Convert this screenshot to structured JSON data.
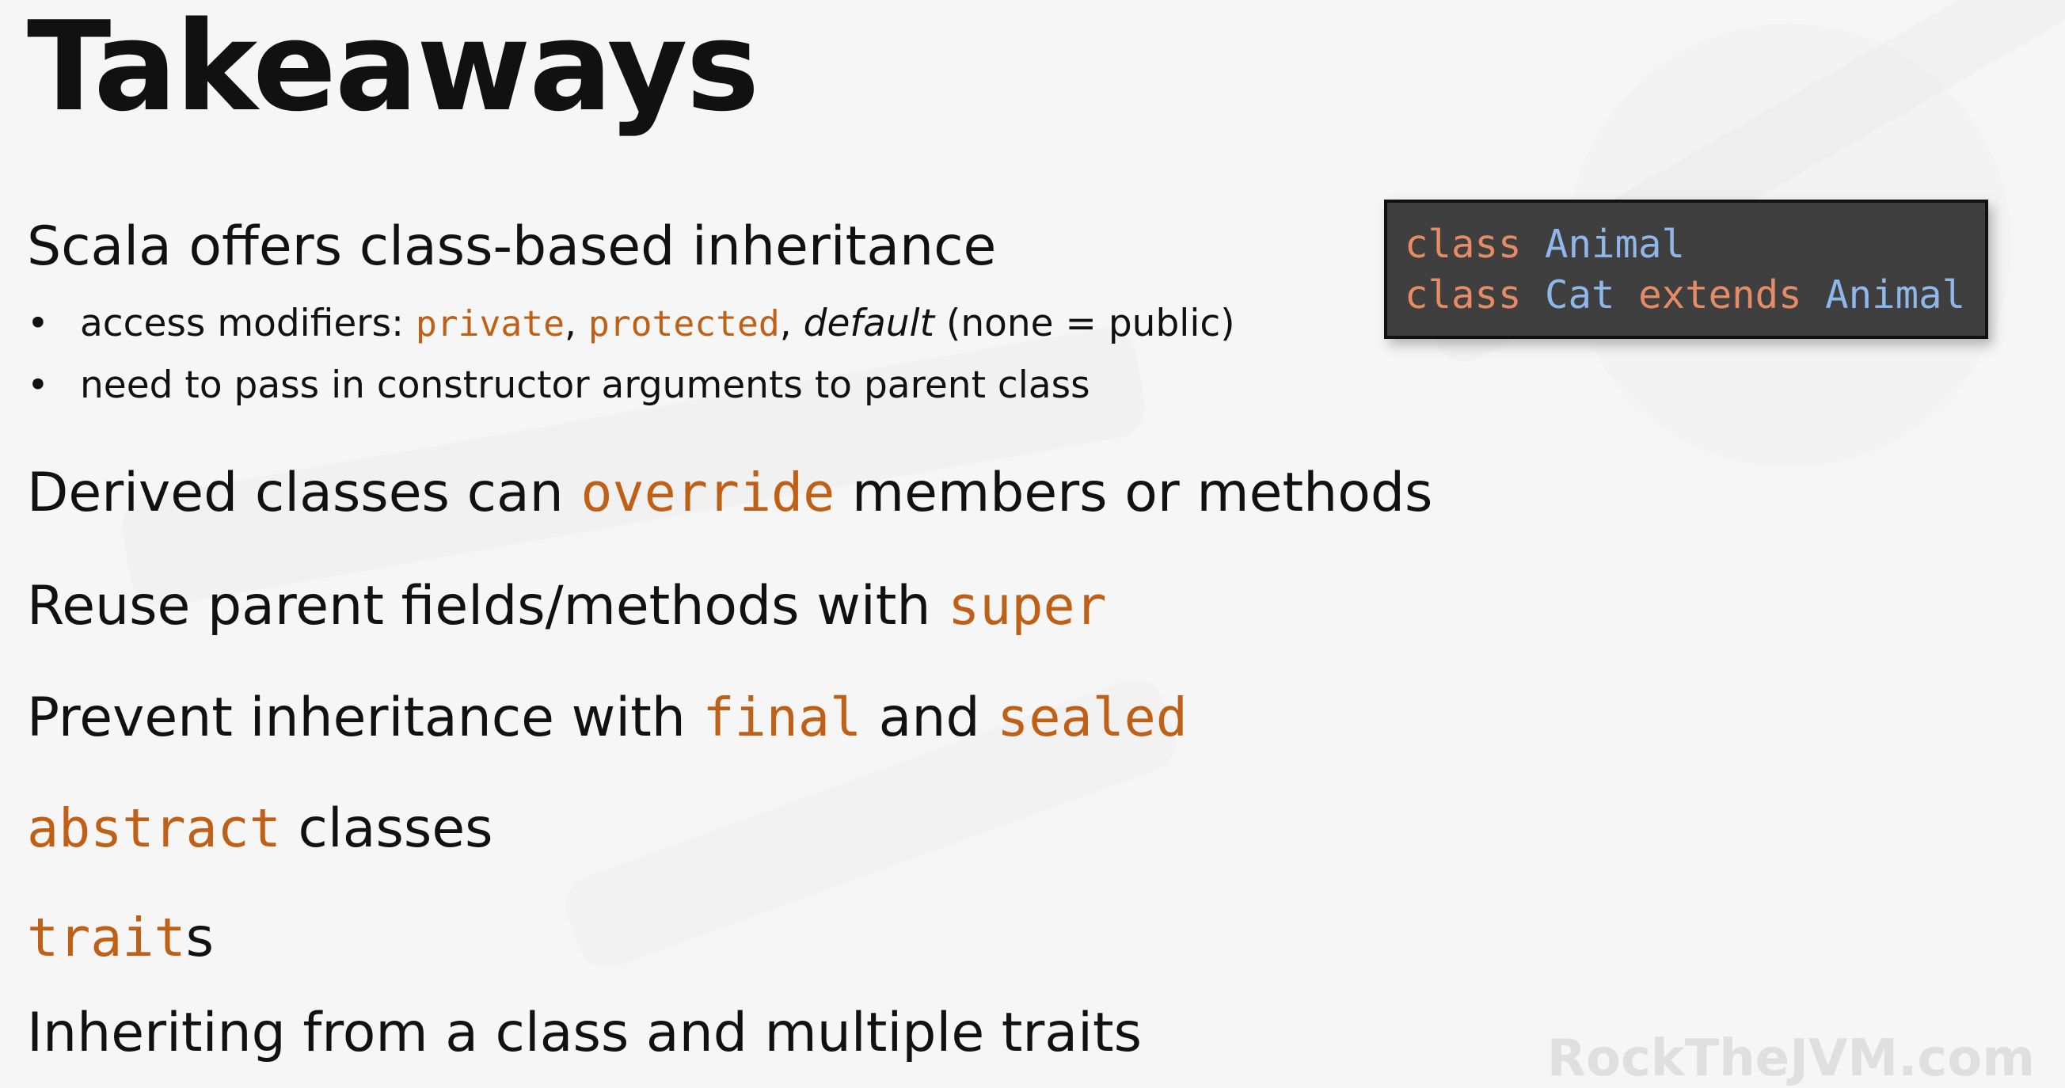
{
  "slide": {
    "title": "Takeaways",
    "item1": {
      "text": "Scala offers class-based inheritance",
      "bullets": [
        {
          "marker": "•",
          "prefix": "access modifiers: ",
          "private": "private",
          "comma1": ", ",
          "protected": "protected",
          "comma2": ", ",
          "default": "default",
          "suffix": " (none = public)"
        },
        {
          "marker": "•",
          "text": "need to pass in constructor arguments to parent class"
        }
      ]
    },
    "item2": {
      "before": "Derived classes can ",
      "code": "override",
      "after": " members or methods"
    },
    "item3": {
      "before": "Reuse parent fields/methods with ",
      "code": "super"
    },
    "item4": {
      "before": "Prevent inheritance with ",
      "code1": "final",
      "middle": " and ",
      "code2": "sealed"
    },
    "item5": {
      "code": "abstract",
      "after": " classes"
    },
    "item6": {
      "code": "trait",
      "after": "s"
    },
    "item7": {
      "text": "Inheriting from a class and multiple traits"
    }
  },
  "code_snippet": {
    "line1": {
      "keyword": "class",
      "space": " ",
      "name": "Animal"
    },
    "line2": {
      "keyword1": "class",
      "space1": " ",
      "name": "Cat",
      "space2": " ",
      "keyword2": "extends",
      "space3": " ",
      "parent": "Animal"
    }
  },
  "watermark": "RockTheJVM.com",
  "colors": {
    "background": "#f6f6f6",
    "text": "#111111",
    "code_orange": "#c05f16",
    "code_box_bg": "#3f3f3f",
    "code_keyword": "#e58c66",
    "code_type": "#8fb7ea"
  }
}
